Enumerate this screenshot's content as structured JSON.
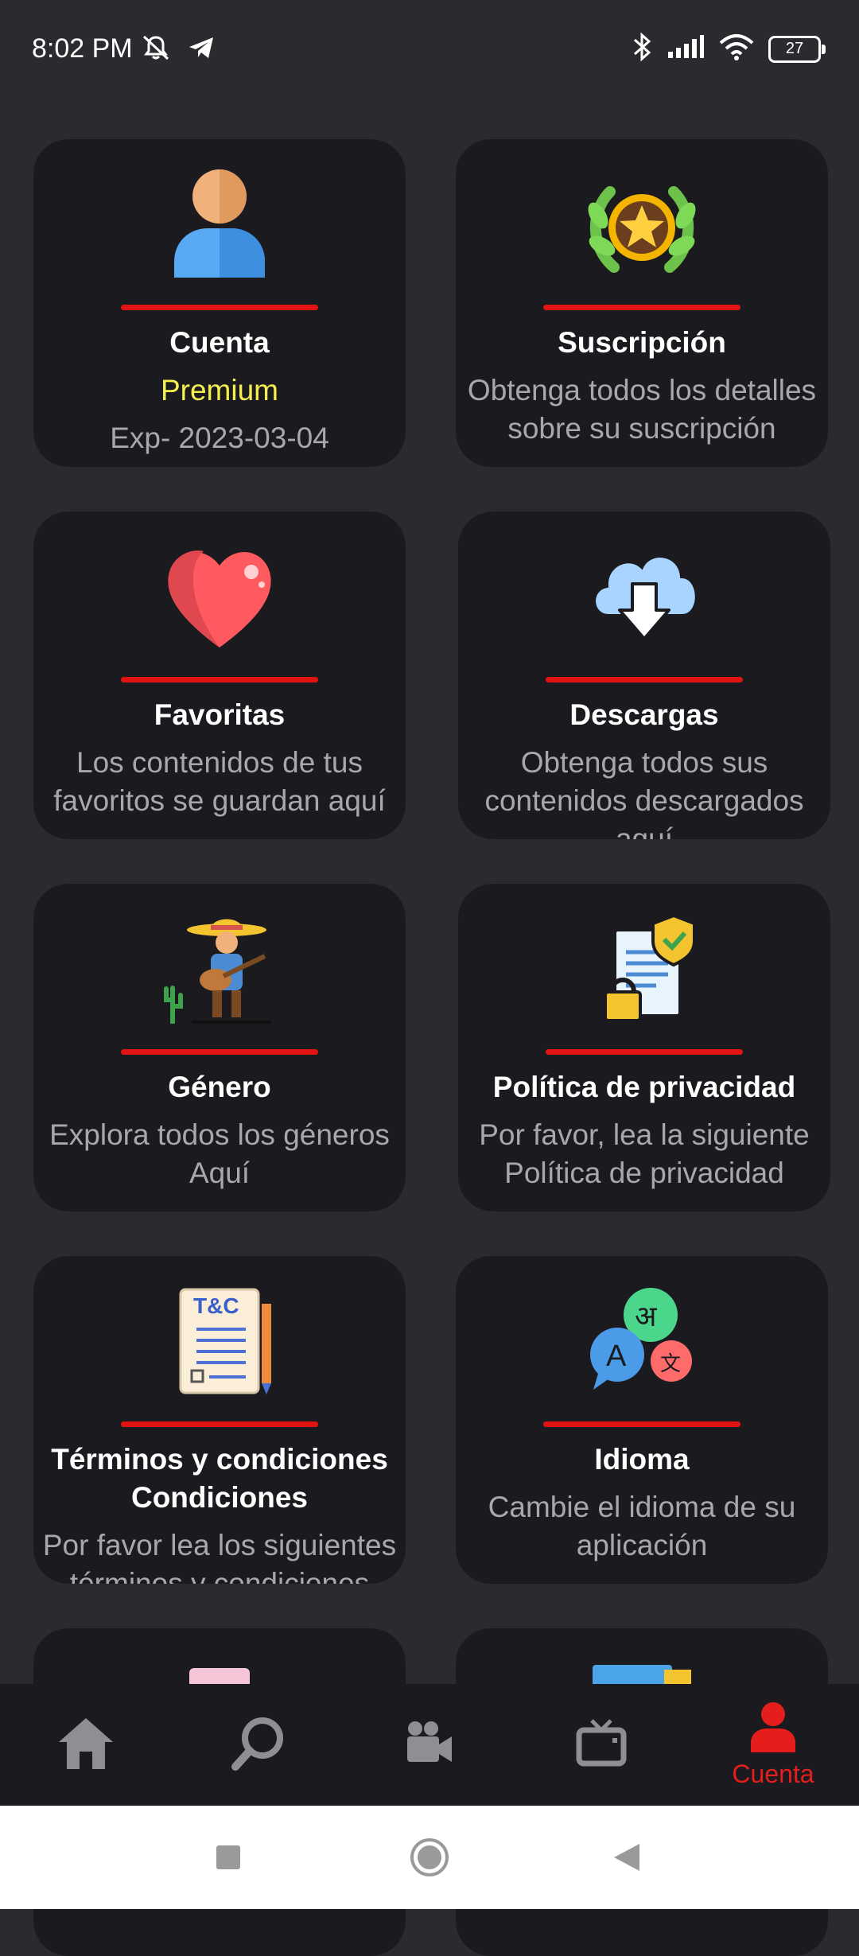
{
  "status_bar": {
    "time": "8:02 PM",
    "battery": "27",
    "icons": [
      "mute-icon",
      "telegram-icon",
      "bluetooth-icon",
      "signal-icon",
      "wifi-icon",
      "battery-icon"
    ]
  },
  "cards": [
    {
      "icon": "user-icon",
      "title": "Cuenta",
      "premium": "Premium",
      "exp": "Exp- 2023-03-04"
    },
    {
      "icon": "laurel-star-icon",
      "title": "Suscripción",
      "desc": "Obtenga todos los detalles sobre su suscripción"
    },
    {
      "icon": "heart-icon",
      "title": "Favoritas",
      "desc": "Los contenidos de tus favoritos se guardan aquí"
    },
    {
      "icon": "cloud-download-icon",
      "title": "Descargas",
      "desc": "Obtenga todos sus contenidos descargados aquí"
    },
    {
      "icon": "guitarist-icon",
      "title": "Género",
      "desc": "Explora todos los géneros Aquí"
    },
    {
      "icon": "privacy-document-icon",
      "title": "Política de privacidad",
      "desc": "Por favor, lea la siguiente Política de privacidad"
    },
    {
      "icon": "terms-document-icon",
      "title": "Términos y condiciones Condiciones",
      "desc": "Por favor lea los siguientes términos y condiciones"
    },
    {
      "icon": "language-icon",
      "title": "Idioma",
      "desc": "Cambie el idioma de su aplicación"
    }
  ],
  "bottom_nav": {
    "items": [
      {
        "icon": "home-icon",
        "label": ""
      },
      {
        "icon": "search-icon",
        "label": ""
      },
      {
        "icon": "video-camera-icon",
        "label": ""
      },
      {
        "icon": "tv-icon",
        "label": ""
      },
      {
        "icon": "account-icon",
        "label": "Cuenta",
        "active": true
      }
    ],
    "active_color": "#e51d1d",
    "inactive_color": "#8e8e93"
  },
  "colors": {
    "background": "#2b2b2f",
    "card": "#1b1b1f",
    "divider": "#e21313",
    "premium": "#f4ef4d",
    "description": "#a7a7ad"
  }
}
